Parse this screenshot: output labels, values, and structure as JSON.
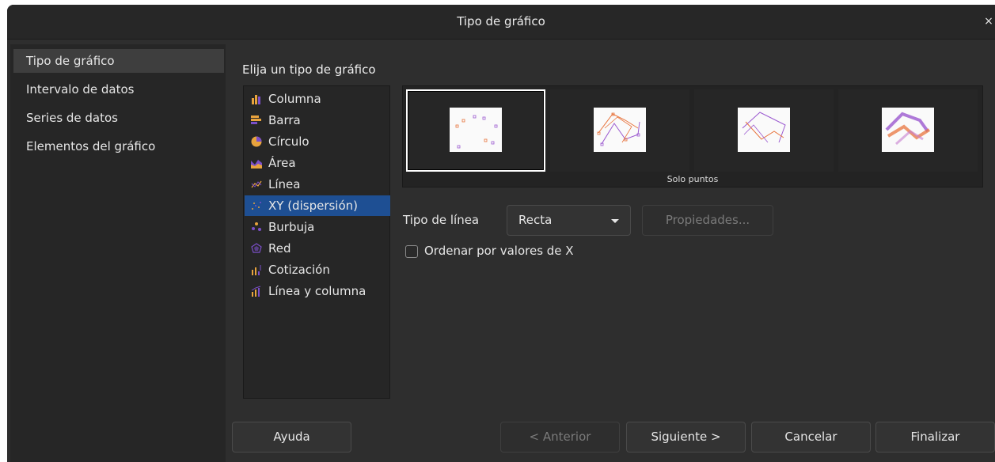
{
  "dialog": {
    "title": "Tipo de gráfico",
    "close_symbol": "×"
  },
  "sidebar": {
    "items": [
      {
        "label": "Tipo de gráfico",
        "active": true
      },
      {
        "label": "Intervalo de datos",
        "active": false
      },
      {
        "label": "Series de datos",
        "active": false
      },
      {
        "label": "Elementos del gráfico",
        "active": false
      }
    ]
  },
  "main": {
    "heading": "Elija un tipo de gráfico",
    "chart_types": [
      {
        "label": "Columna",
        "icon": "column-chart-icon"
      },
      {
        "label": "Barra",
        "icon": "bar-chart-icon"
      },
      {
        "label": "Círculo",
        "icon": "pie-chart-icon"
      },
      {
        "label": "Área",
        "icon": "area-chart-icon"
      },
      {
        "label": "Línea",
        "icon": "line-chart-icon"
      },
      {
        "label": "XY (dispersión)",
        "icon": "xy-scatter-icon",
        "selected": true
      },
      {
        "label": "Burbuja",
        "icon": "bubble-chart-icon"
      },
      {
        "label": "Red",
        "icon": "net-chart-icon"
      },
      {
        "label": "Cotización",
        "icon": "stock-chart-icon"
      },
      {
        "label": "Línea y columna",
        "icon": "column-line-chart-icon"
      }
    ],
    "variants": [
      {
        "icon": "points-only-icon",
        "selected": true
      },
      {
        "icon": "points-and-lines-icon",
        "selected": false
      },
      {
        "icon": "lines-only-icon",
        "selected": false
      },
      {
        "icon": "3d-lines-icon",
        "selected": false
      }
    ],
    "variant_caption": "Solo puntos",
    "line_type_label": "Tipo de línea",
    "line_type_value": "Recta",
    "properties_button": "Propiedades...",
    "sort_checkbox_label": "Ordenar por valores de X",
    "sort_checked": false
  },
  "footer": {
    "help": "Ayuda",
    "previous": "< Anterior",
    "next": "Siguiente >",
    "cancel": "Cancelar",
    "finish": "Finalizar"
  },
  "colors": {
    "dialog_bg": "#2e2e2e",
    "selection": "#1e4f93"
  }
}
